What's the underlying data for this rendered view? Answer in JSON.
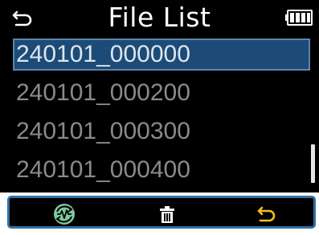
{
  "header": {
    "title": "File List",
    "back_icon": "back-arrow-icon",
    "battery_icon": "battery-icon"
  },
  "files": [
    {
      "name": "240101_000000",
      "selected": true
    },
    {
      "name": "240101_000200",
      "selected": false
    },
    {
      "name": "240101_000300",
      "selected": false
    },
    {
      "name": "240101_000400",
      "selected": false
    }
  ],
  "toolbar": {
    "buttons": [
      {
        "icon": "waveform-sync-icon"
      },
      {
        "icon": "trash-icon"
      },
      {
        "icon": "back-arrow-icon"
      }
    ]
  },
  "colors": {
    "selection": "#1d4b77",
    "toolbar_border": "#2f6fa3",
    "sync_icon_bg": "#7fc99a"
  }
}
